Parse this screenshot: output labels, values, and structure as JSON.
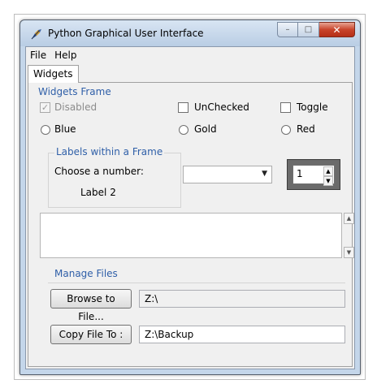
{
  "window": {
    "title": "Python Graphical User Interface"
  },
  "caption_buttons": {
    "minimize": "–",
    "maximize": "□",
    "close": "✕"
  },
  "menu": {
    "items": [
      "File",
      "Help"
    ]
  },
  "tabs": [
    {
      "label": "Widgets"
    }
  ],
  "widgets_frame": {
    "title": "Widgets Frame",
    "checkboxes": [
      {
        "label": "Disabled",
        "checked": true,
        "disabled": true
      },
      {
        "label": "UnChecked",
        "checked": false,
        "disabled": false
      },
      {
        "label": "Toggle",
        "checked": false,
        "disabled": false
      }
    ],
    "radios": [
      {
        "label": "Blue"
      },
      {
        "label": "Gold"
      },
      {
        "label": "Red"
      }
    ]
  },
  "labels_frame": {
    "title": "Labels within a Frame",
    "choose_label": "Choose a number:",
    "label2": "Label 2"
  },
  "combobox": {
    "value": ""
  },
  "spinbox": {
    "value": "1"
  },
  "scrolled_text": {
    "value": ""
  },
  "manage_files": {
    "title": "Manage Files",
    "browse_button": "Browse to File...",
    "browse_path": "Z:\\",
    "copy_button": "Copy File To :",
    "copy_path": "Z:\\Backup"
  },
  "colors": {
    "group_title": "#2f5fa8",
    "window_frame": "#c4d6ea",
    "close_button": "#c8442b"
  }
}
